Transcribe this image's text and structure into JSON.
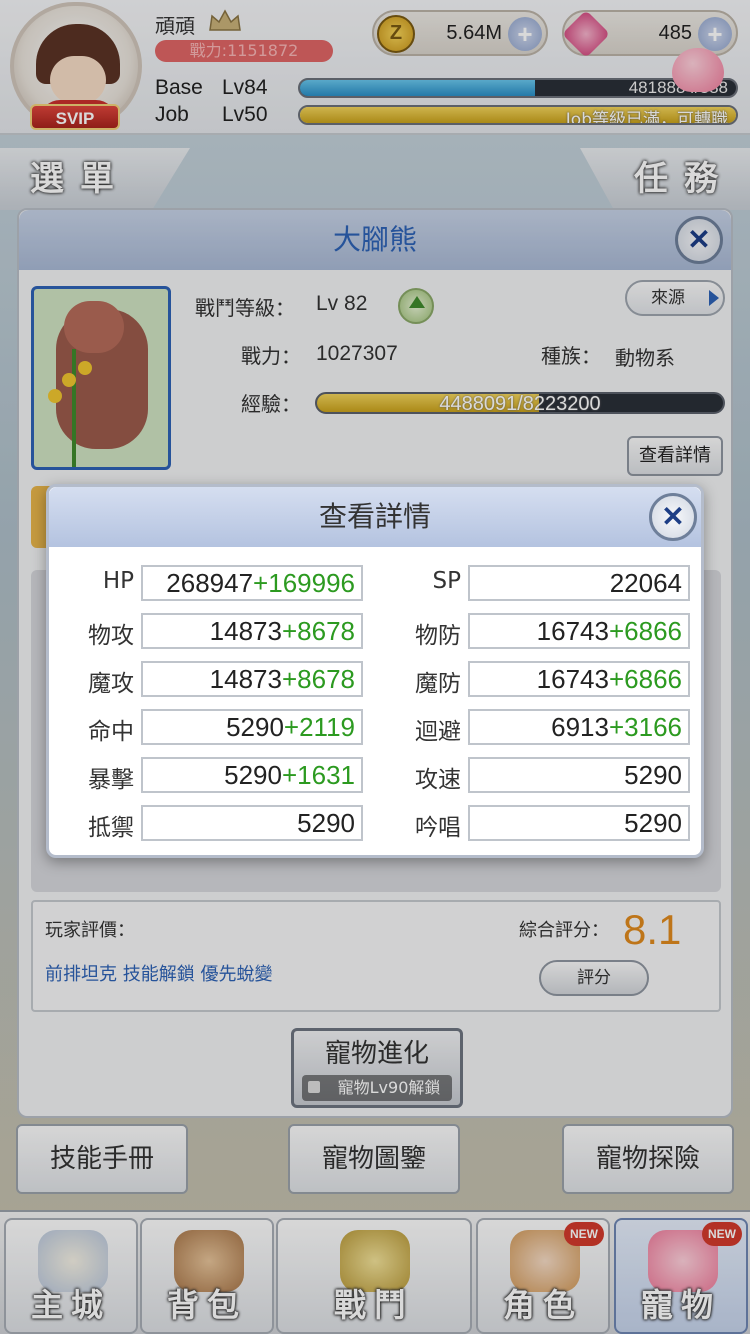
{
  "hud": {
    "player_name": "頑頑",
    "power_text": "戰力:1151872",
    "svip": "SVIP",
    "zeny": "5.64M",
    "gems": "485",
    "base_label": "Base",
    "base_level": "Lv84",
    "base_exp_text": "4818884/888",
    "base_progress": 0.54,
    "job_label": "Job",
    "job_level": "Lv50",
    "job_text": "Job等級已滿，可轉職",
    "job_progress": 1.0
  },
  "side_tabs": {
    "menu": "選單",
    "task": "任務"
  },
  "pet": {
    "name": "大腳熊",
    "battle_level_label": "戰鬥等級：",
    "battle_level": "Lv 82",
    "power_label": "戰力：",
    "power": "1027307",
    "race_label": "種族：",
    "race": "動物系",
    "exp_label": "經驗：",
    "exp_text": "4488091/8223200",
    "exp_progress": 0.546,
    "source_button": "來源",
    "detail_button": "查看詳情",
    "eval_label": "玩家評價：",
    "eval_tags": "前排坦克 技能解鎖 優先蛻變",
    "score_label": "綜合評分：",
    "score": "8.1",
    "rate_button": "評分",
    "evolve_button": "寵物進化",
    "evolve_lock": "寵物Lv90解鎖"
  },
  "sub_tabs": {
    "skill": "技能手冊",
    "codex": "寵物圖鑒",
    "explore": "寵物探險"
  },
  "nav": {
    "city": "主城",
    "bag": "背包",
    "battle": "戰鬥",
    "character": "角色",
    "pet": "寵物",
    "new_badge": "NEW"
  },
  "dialog": {
    "title": "查看詳情",
    "stats_left": [
      {
        "label": "HP",
        "base": "268947",
        "bonus": "+169996"
      },
      {
        "label": "物攻",
        "base": "14873",
        "bonus": "+8678"
      },
      {
        "label": "魔攻",
        "base": "14873",
        "bonus": "+8678"
      },
      {
        "label": "命中",
        "base": "5290",
        "bonus": "+2119"
      },
      {
        "label": "暴擊",
        "base": "5290",
        "bonus": "+1631"
      },
      {
        "label": "抵禦",
        "base": "5290",
        "bonus": ""
      }
    ],
    "stats_right": [
      {
        "label": "SP",
        "base": "22064",
        "bonus": ""
      },
      {
        "label": "物防",
        "base": "16743",
        "bonus": "+6866"
      },
      {
        "label": "魔防",
        "base": "16743",
        "bonus": "+6866"
      },
      {
        "label": "迴避",
        "base": "6913",
        "bonus": "+3166"
      },
      {
        "label": "攻速",
        "base": "5290",
        "bonus": ""
      },
      {
        "label": "吟唱",
        "base": "5290",
        "bonus": ""
      }
    ]
  }
}
